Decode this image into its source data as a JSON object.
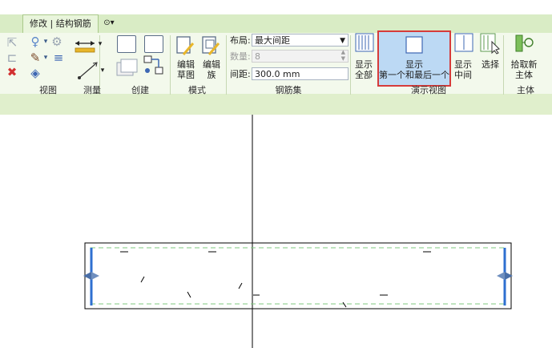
{
  "context_tab": {
    "label": "修改 | 结构钢筋"
  },
  "qat": {
    "symbol": "⊙▾"
  },
  "panels": {
    "view": "视图",
    "measure": "测量",
    "create": "创建",
    "mode": "模式",
    "rebar_set": "钢筋集",
    "presentation": "演示视图",
    "host": "主体"
  },
  "mode_buttons": {
    "edit_sketch": [
      "编辑",
      "草图"
    ],
    "edit_family": [
      "编辑",
      "族"
    ]
  },
  "rebar_set": {
    "layout_label": "布局:",
    "layout_value": "最大间距",
    "quantity_label": "数量:",
    "quantity_value": "8",
    "spacing_label": "间距:",
    "spacing_value": "300.0 mm"
  },
  "presentation_buttons": {
    "show_all": [
      "显示",
      "全部"
    ],
    "show_first_last": [
      "显示",
      "第一个和最后一个"
    ],
    "show_middle": [
      "显示",
      "中间"
    ],
    "select": "选择"
  },
  "host_button": [
    "拾取新",
    "主体"
  ],
  "colors": {
    "ribbon_bg": "#f3f9ec",
    "tab_strip": "#d9ecc5",
    "highlight": "#bcd9f4",
    "highlight_border": "#d63b3b",
    "rebar_blue": "#2e6fd0",
    "cover_dashed": "#7fc97f"
  }
}
